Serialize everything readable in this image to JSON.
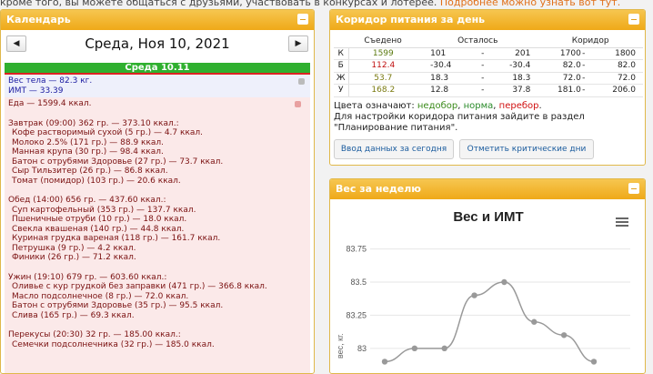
{
  "top_line": {
    "text": "кроме того, вы можете общаться с друзьями, участвовать в конкурсах и лотерее.",
    "link": "Подробнее можно узнать вот тут."
  },
  "calendar": {
    "header": "Календарь",
    "prev": "◀",
    "next": "▶",
    "date": "Среда, Ноя 10, 2021",
    "day_label": "Среда 10.11",
    "weight": "Вес тела — 82.3 кг.",
    "bmi": "ИМТ — 33.39",
    "food_total": "Еда — 1599.4 ккал.",
    "meals": [
      {
        "title": "Завтрак (09:00) 362 гр. — 373.10 ккал.:",
        "items": [
          "Кофе растворимый сухой (5 гр.) — 4.7 ккал.",
          "Молоко 2.5% (171 гр.) — 88.9 ккал.",
          "Манная крупа (30 гр.) — 98.4 ккал.",
          "Батон с отрубями Здоровье (27 гр.) — 73.7 ккал.",
          "Сыр Тильзитер (26 гр.) — 86.8 ккал.",
          "Томат (помидор) (103 гр.) — 20.6 ккал."
        ]
      },
      {
        "title": "Обед (14:00) 656 гр. — 437.60 ккал.:",
        "items": [
          "Суп картофельный (353 гр.) — 137.7 ккал.",
          "Пшеничные отруби (10 гр.) — 18.0 ккал.",
          "Свекла квашеная (140 гр.) — 44.8 ккал.",
          "Куриная грудка вареная (118 гр.) — 161.7 ккал.",
          "Петрушка (9 гр.) — 4.2 ккал.",
          "Финики (26 гр.) — 71.2 ккал."
        ]
      },
      {
        "title": "Ужин (19:10) 679 гр. — 603.60 ккал.:",
        "items": [
          "Оливье с кур грудкой без заправки (471 гр.) — 366.8 ккал.",
          "Масло подсолнечное (8 гр.) — 72.0 ккал.",
          "Батон с отрубями Здоровье (35 гр.) — 95.5 ккал.",
          "Слива (165 гр.) — 69.3 ккал."
        ]
      },
      {
        "title": "Перекусы (20:30) 32 гр. — 185.00 ккал.:",
        "items": [
          "Семечки подсолнечника (32 гр.) — 185.0 ккал."
        ]
      }
    ]
  },
  "corridor": {
    "header": "Коридор питания за день",
    "columns": [
      "",
      "Съедено",
      "Осталось",
      "Коридор"
    ],
    "rows": [
      {
        "label": "К",
        "eaten": "1599",
        "left_from": "101",
        "dash1": "-",
        "left_to": "201",
        "from": "1700",
        "dash2": "-",
        "to": "1800"
      },
      {
        "label": "Б",
        "eaten": "112.4",
        "left_from": "-30.4",
        "dash1": "-",
        "left_to": "-30.4",
        "from": "82.0",
        "dash2": "-",
        "to": "82.0"
      },
      {
        "label": "Ж",
        "eaten": "53.7",
        "left_from": "18.3",
        "dash1": "-",
        "left_to": "18.3",
        "from": "72.0",
        "dash2": "-",
        "to": "72.0"
      },
      {
        "label": "У",
        "eaten": "168.2",
        "left_from": "12.8",
        "dash1": "-",
        "left_to": "37.8",
        "from": "181.0",
        "dash2": "-",
        "to": "206.0"
      }
    ],
    "legend_prefix": "Цвета означают:",
    "legend_under": "недобор",
    "legend_norm": "норма",
    "legend_over": "перебор",
    "note": "Для настройки коридора питания зайдите в раздел \"Планирование питания\".",
    "btn_input": "Ввод данных за сегодня",
    "btn_critical": "Отметить критические дни",
    "colors": {
      "under": "#3a8a1a",
      "norm": "#2a8a2a",
      "over": "#d01010"
    }
  },
  "weight_panel": {
    "header": "Вес за неделю"
  },
  "chart_data": {
    "type": "line",
    "title": "Вес и ИМТ",
    "ylabel": "вес, кг.",
    "yticks": [
      "83.75",
      "83.5",
      "83.25",
      "83"
    ],
    "ylim": [
      82.8,
      83.85
    ],
    "series": [
      {
        "values": [
          82.9,
          83.0,
          83.0,
          83.4,
          83.5,
          83.2,
          83.1,
          82.9
        ]
      }
    ],
    "color": "#999999",
    "grid": true
  }
}
